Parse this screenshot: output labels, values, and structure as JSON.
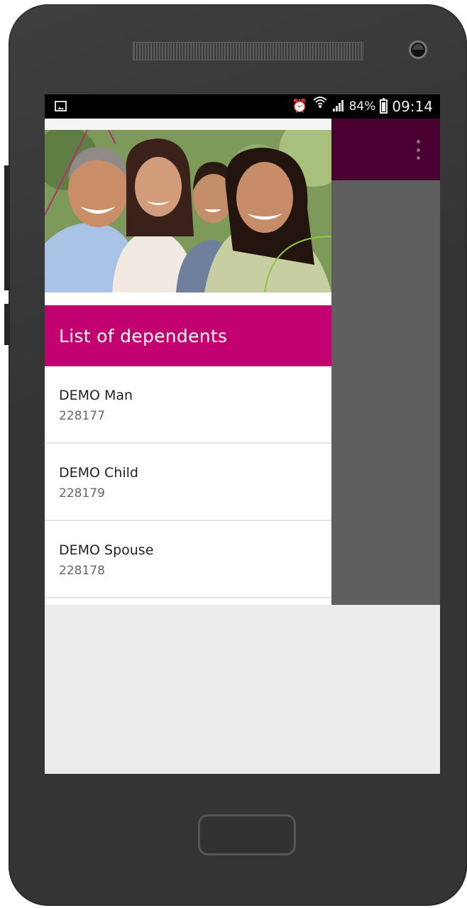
{
  "status_bar": {
    "battery_percent": "84%",
    "time": "09:14",
    "icons": [
      "image-icon",
      "alarm-icon",
      "wifi-icon",
      "signal-icon",
      "battery-icon"
    ]
  },
  "app_bar": {
    "menu_icon": "overflow-menu-icon",
    "color": "#4a0030"
  },
  "drawer": {
    "header_image": "family-photo",
    "title": "List of dependents",
    "accent_color": "#c3006f",
    "dependents": [
      {
        "name": "DEMO Man",
        "id": "228177"
      },
      {
        "name": "DEMO Child",
        "id": "228179"
      },
      {
        "name": "DEMO Spouse",
        "id": "228178"
      }
    ]
  }
}
